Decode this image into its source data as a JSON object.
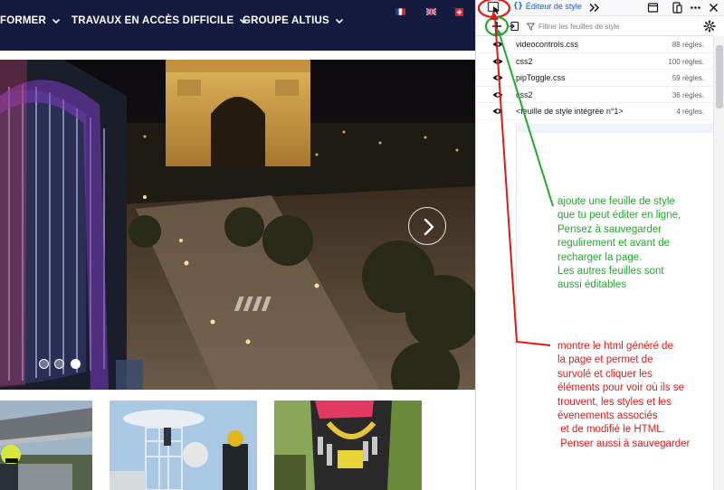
{
  "website": {
    "nav": {
      "items": [
        {
          "label": "FORMER"
        },
        {
          "label": "TRAVAUX EN ACCÈS DIFFICILE"
        },
        {
          "label": "GROUPE ALTIUS"
        }
      ],
      "flags": [
        "french-flag-icon",
        "uk-flag-icon",
        "swiss-flag-icon"
      ]
    },
    "slider": {
      "slide_count": 3,
      "active_slide": 3
    }
  },
  "devtools": {
    "tab": {
      "label": "Éditeur de style"
    },
    "filter": {
      "placeholder": "Filtrer les feuilles de style"
    },
    "sheets": [
      {
        "name": "videocontrols.css",
        "rules": "88 règles."
      },
      {
        "name": "css2",
        "rules": "100 règles."
      },
      {
        "name": "pipToggle.css",
        "rules": "59 règles."
      },
      {
        "name": "css2",
        "rules": "36 règles."
      },
      {
        "name": "<feuille de style intégrée n°1>",
        "rules": "4 règles."
      }
    ]
  },
  "annotations": {
    "green": "ajoute une feuille de style\nque tu peut éditer en ligne,\nPensez à sauvegarder\nregulirement et avant de\nrecharger la page.\nLes autres feuilles sont\naussi éditables",
    "red": "montre le html généré de\nla page et permet de\nsurvolé et cliquer les\néléments pour voir où ils se\ntrouvent, les styles et les\névenements associés\n et de modifié le HTML.\n Penser aussi à sauvegarder"
  },
  "colors": {
    "nav_bg": "#141b3f",
    "green_annotation": "#1faa2b",
    "red_annotation": "#e01818",
    "devtools_accent": "#0060df"
  }
}
